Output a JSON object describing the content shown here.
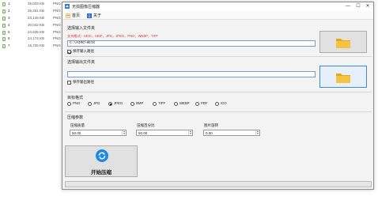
{
  "file_list": [
    {
      "name": "1",
      "size": "35,033 KB",
      "type": "PNG"
    },
    {
      "name": "2",
      "size": "26,261 KB",
      "type": "PNG"
    },
    {
      "name": "3",
      "size": "23,146 KB",
      "type": "PNG"
    },
    {
      "name": "4",
      "size": "20,042 KB",
      "type": "PNG"
    },
    {
      "name": "5",
      "size": "24,635 KB",
      "type": "PNG"
    },
    {
      "name": "6",
      "size": "24,174 KB",
      "type": "PNG"
    },
    {
      "name": "7",
      "size": "16,725 KB",
      "type": "PNG"
    }
  ],
  "window": {
    "title": "无损图像压缩器",
    "controls": {
      "minimize": "—",
      "maximize": "☐",
      "close": "✕"
    }
  },
  "menu": {
    "home": "首页",
    "about": "关于"
  },
  "input": {
    "section_label": "选择输入文件夹",
    "formats_hint": "支持格式：HEIC，HEIF，JPG，JPEG，PNG，WEBP，TIFF",
    "path": "C:\\AIMG\\HEIC",
    "save_path_label": "保存输入路径",
    "save_path_checked": true
  },
  "output": {
    "section_label": "选择输出文件夹",
    "path": "",
    "save_path_label": "保存输出路径",
    "save_path_checked": false
  },
  "format": {
    "section_label": "目标格式",
    "options": [
      "PNG",
      "JPG",
      "JPEG",
      "BMP",
      "TIFF",
      "WEBP",
      "PDF",
      "ICO"
    ],
    "selected": "JPEG"
  },
  "params": {
    "section_label": "压缩参数",
    "quality_label": "压缩质量",
    "quality_value": "50.00",
    "percent_label": "压缩百分比",
    "percent_value": "50.00",
    "rotate_label": "图片旋转",
    "rotate_value": "0.00"
  },
  "actions": {
    "start_label": "开始压缩"
  },
  "colors": {
    "accent": "#0078d4",
    "hint_red": "#dd3333",
    "folder": "#f5c242"
  }
}
